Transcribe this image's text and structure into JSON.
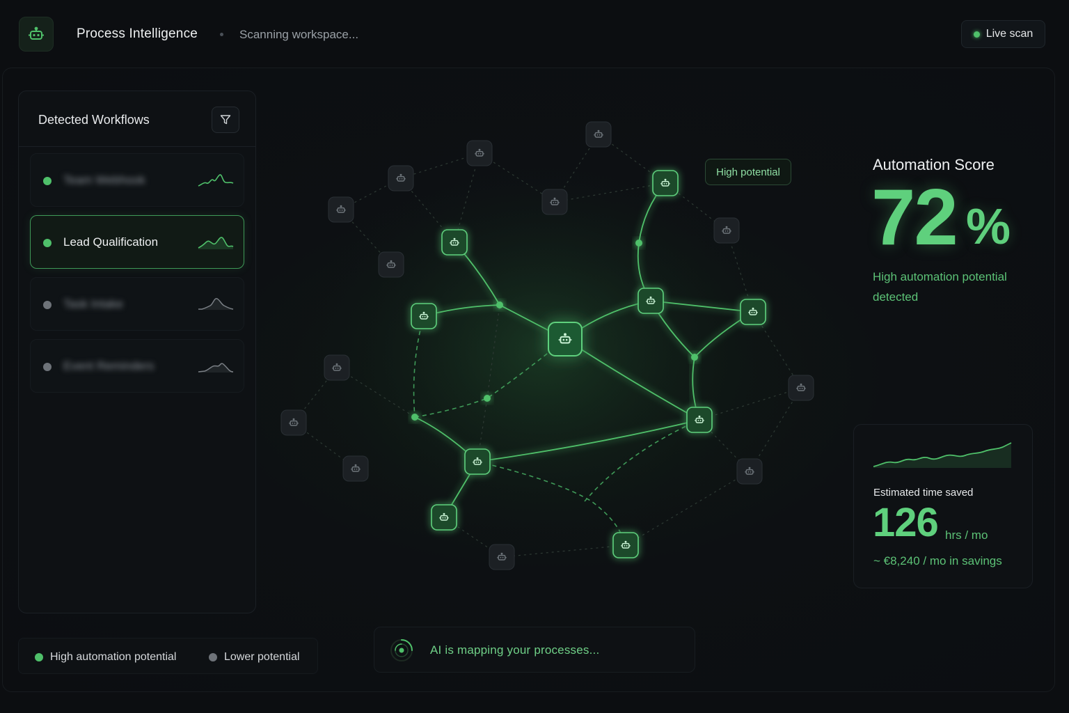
{
  "header": {
    "app_title": "Process Intelligence",
    "status": "Scanning workspace...",
    "live_label": "Live scan",
    "logo_icon": "workflow-bot-icon"
  },
  "sidebar": {
    "title": "Detected Workflows",
    "filter_icon": "filter-icon",
    "items": [
      {
        "label": "Team Webhook",
        "potential": "high",
        "blurred": true
      },
      {
        "label": "Lead Qualification",
        "potential": "high",
        "blurred": false,
        "active": true
      },
      {
        "label": "Task Intake",
        "potential": "low",
        "blurred": true
      },
      {
        "label": "Event Reminders",
        "potential": "low",
        "blurred": true
      }
    ]
  },
  "legend": {
    "high": "High automation potential",
    "low": "Lower potential"
  },
  "ai_status": {
    "text": "AI is mapping your processes..."
  },
  "graph": {
    "tag": "High potential"
  },
  "score": {
    "title": "Automation Score",
    "value": "72",
    "unit": "%",
    "percent": 72,
    "caption": "High automation potential detected"
  },
  "savings": {
    "label": "Estimated time saved",
    "value": "126",
    "unit": "hrs / mo",
    "money": "~ €8,240 / mo in savings"
  },
  "colors": {
    "accent": "#4fc06a",
    "accent_text": "#5fd07d",
    "muted_dot": "#6e7379",
    "background": "#0c0e11"
  }
}
